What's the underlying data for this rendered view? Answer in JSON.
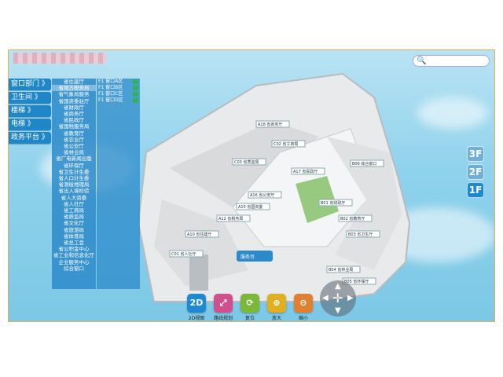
{
  "search": {
    "placeholder": ""
  },
  "menu": [
    {
      "label": "窗口部门 》"
    },
    {
      "label": "卫生间 》"
    },
    {
      "label": "楼梯 》"
    },
    {
      "label": "电梯 》"
    },
    {
      "label": "政务平台 》"
    }
  ],
  "panel1": [
    "省住建厅",
    "省地方税务局",
    "省气象局服务",
    "省国资委驻厅",
    "省财政厅",
    "省商务厅",
    "省民政厅",
    "省国税服务局",
    "省教育厅",
    "省农业厅",
    "省公安厅",
    "省林业局",
    "省广电新闻出版",
    "省环保厅",
    "省卫生计生委",
    "省人口计生委",
    "省测绘地理局",
    "省出入境检验",
    "省人大资委",
    "省人社厅",
    "省工商局",
    "省质监局",
    "省文化厅",
    "省旅游局",
    "省体育局",
    "省总工会",
    "省公积金中心",
    "省工业和信息化厅",
    "企业服务中心",
    "综合窗口"
  ],
  "panel2": [
    "F1 窗口A区",
    "F1 窗口B区",
    "F1 窗口C区",
    "F1 窗口D区"
  ],
  "floors": [
    "3F",
    "2F",
    "1F"
  ],
  "toolbar": [
    {
      "icon": "2D",
      "label": "2D视图",
      "color": "#1e88d0"
    },
    {
      "icon": "⤢",
      "label": "路线规划",
      "color": "#d0508e"
    },
    {
      "icon": "⟳",
      "label": "复位",
      "color": "#7bb83a"
    },
    {
      "icon": "⊕",
      "label": "放大",
      "color": "#e0b020"
    },
    {
      "icon": "⊖",
      "label": "缩小",
      "color": "#e08030"
    }
  ],
  "map_labels": [
    "A10 省住建厅",
    "A12 省税务局",
    "A15 省国资委",
    "A16 省公安厅",
    "A17 省民政厅",
    "A18 省商务厅",
    "B01 省财政厅",
    "B02 省教育厅",
    "B03 省卫生厅",
    "B04 省林业局",
    "B05 省环保厅",
    "B06 综合窗口",
    "C01 省人社厅",
    "C02 省工商局",
    "C03 省质监局",
    "服务台"
  ]
}
